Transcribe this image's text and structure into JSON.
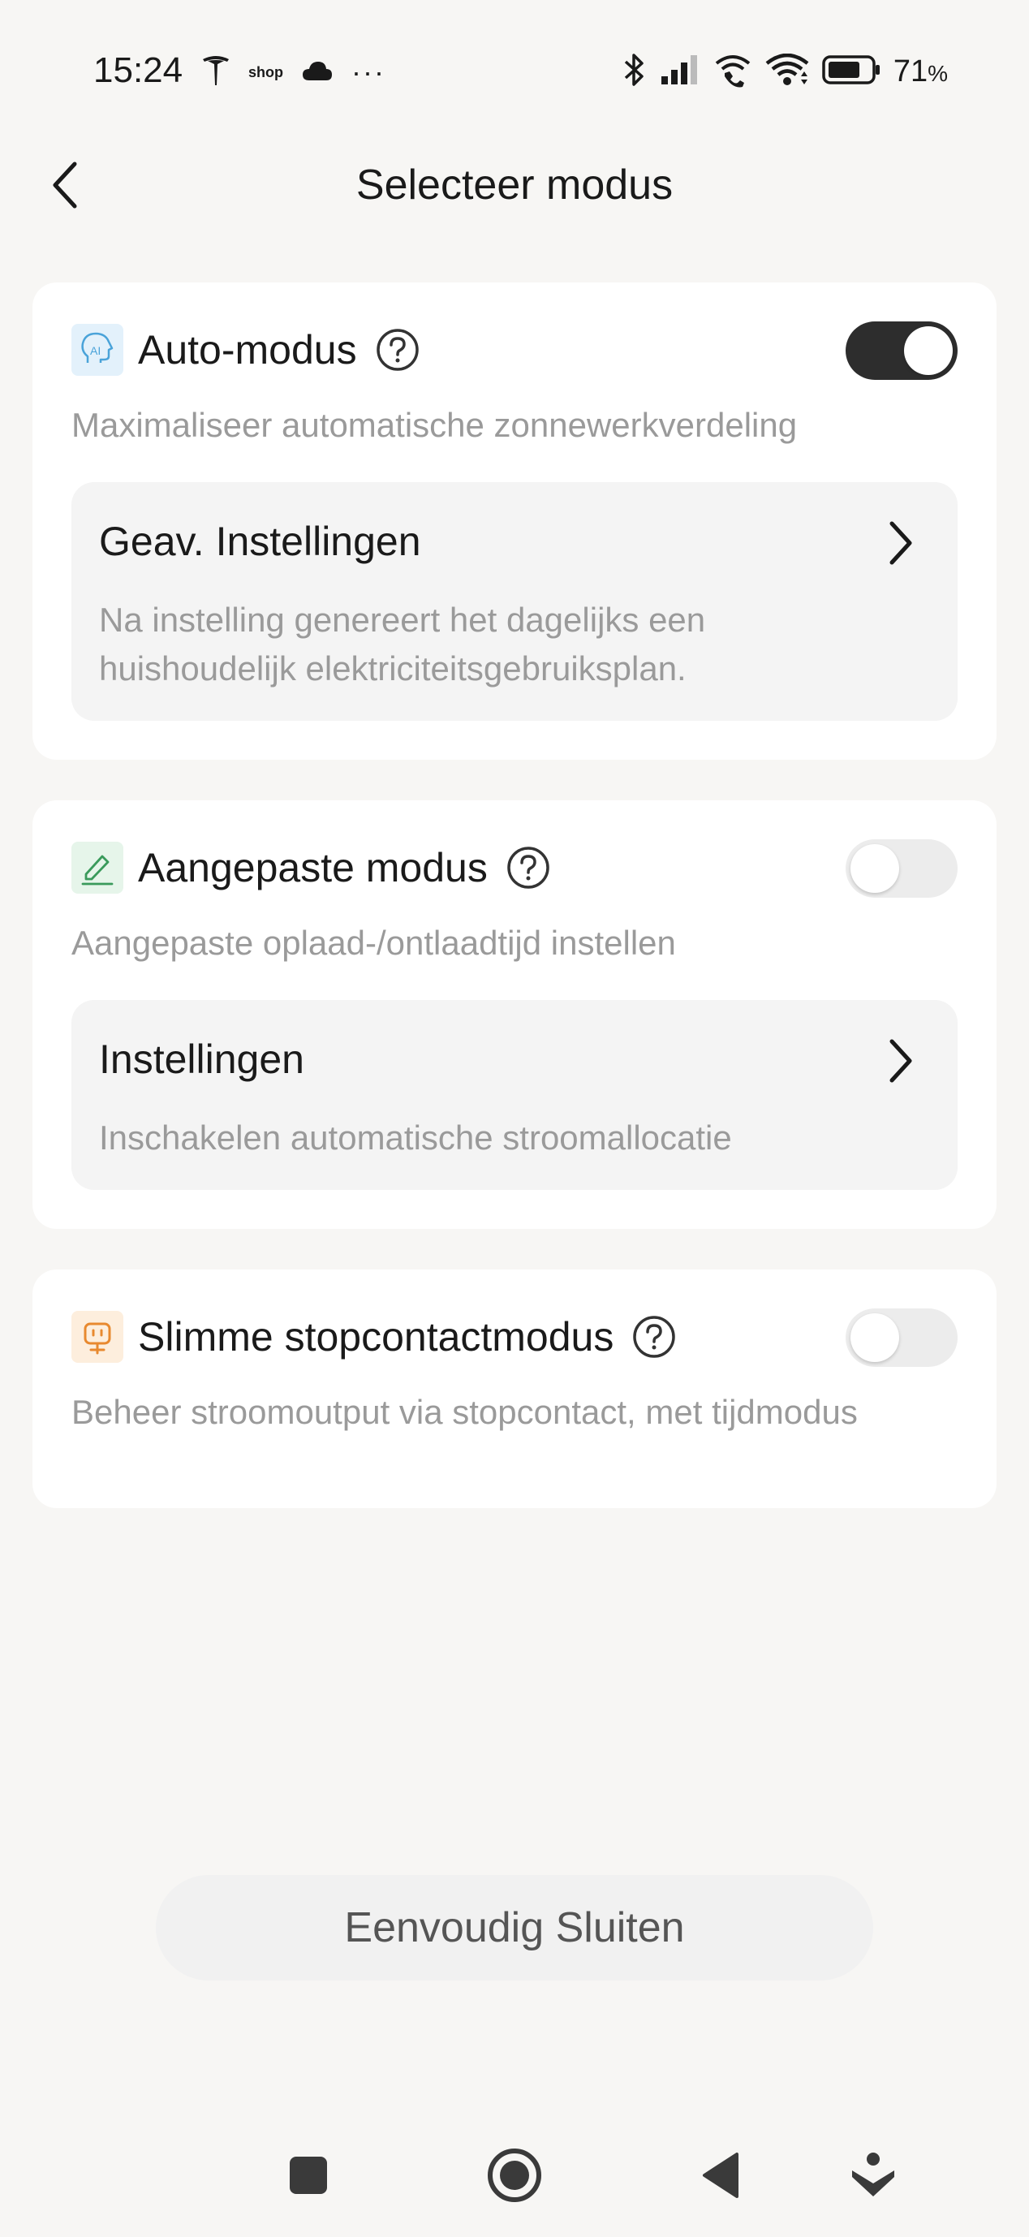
{
  "status_bar": {
    "time": "15:24",
    "shop_label": "shop",
    "more_indicator": "···",
    "battery_percent": "71",
    "battery_unit": "%",
    "icons": [
      "tesla-icon",
      "cloud-icon",
      "bluetooth-icon",
      "signal-icon",
      "wifi-calling-icon",
      "wifi-icon",
      "battery-icon"
    ]
  },
  "header": {
    "title": "Selecteer modus"
  },
  "modes": [
    {
      "title": "Auto-modus",
      "enabled": true,
      "description": "Maximaliseer automatische zonnewerkverdeling",
      "settings_title": "Geav. Instellingen",
      "settings_description": "Na instelling genereert het dagelijks een huishoudelijk elektriciteitsgebruiksplan."
    },
    {
      "title": "Aangepaste modus",
      "enabled": false,
      "description": "Aangepaste oplaad-/ontlaadtijd instellen",
      "settings_title": "Instellingen",
      "settings_description": "Inschakelen automatische stroomallocatie"
    },
    {
      "title": "Slimme stopcontactmodus",
      "enabled": false,
      "description": "Beheer stroomoutput via stopcontact, met tijdmodus"
    }
  ],
  "footer": {
    "close_label": "Eenvoudig Sluiten"
  },
  "colors": {
    "background": "#f7f6f4",
    "toggle_on": "#2d2d2d",
    "toggle_off": "#ececec",
    "auto_icon": "#4aa3d9",
    "custom_icon": "#3a9a5b",
    "plug_icon": "#e8892f",
    "muted_text": "#9a9a9a"
  }
}
